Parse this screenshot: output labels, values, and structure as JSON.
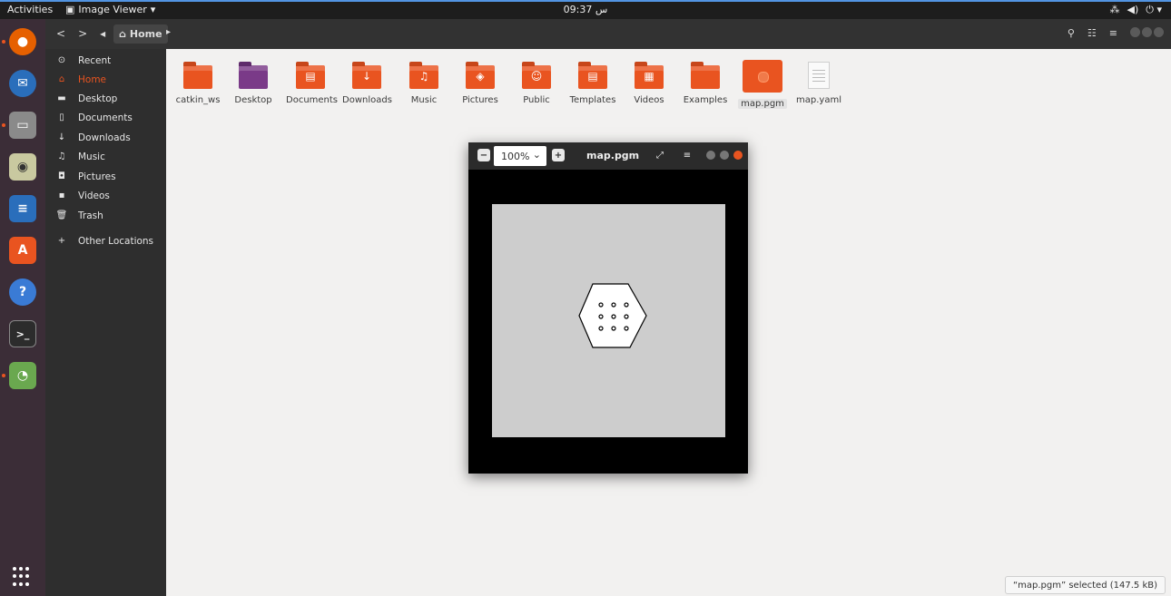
{
  "topbar": {
    "activities": "Activities",
    "app_name": "Image Viewer",
    "clock": "09:37 س",
    "tray": [
      "network-icon",
      "volume-icon",
      "power-icon"
    ]
  },
  "dock": {
    "items": [
      {
        "name": "firefox-icon",
        "color": "#e66000"
      },
      {
        "name": "thunderbird-icon",
        "color": "#2a6ebb"
      },
      {
        "name": "files-icon",
        "color": "#8a8a8a"
      },
      {
        "name": "rhythmbox-icon",
        "color": "#c9c9a0"
      },
      {
        "name": "writer-icon",
        "color": "#2a6ebb"
      },
      {
        "name": "software-icon",
        "color": "#e95420"
      },
      {
        "name": "help-icon",
        "color": "#3a7bd5"
      },
      {
        "name": "terminal-icon",
        "color": "#2c2c2c"
      },
      {
        "name": "image-viewer-icon",
        "color": "#6aa84f"
      }
    ]
  },
  "header": {
    "back": "<",
    "forward": ">",
    "crumb_label": "Home"
  },
  "sidebar": {
    "items": [
      {
        "label": "Recent",
        "icon": "⊙"
      },
      {
        "label": "Home",
        "icon": "⌂"
      },
      {
        "label": "Desktop",
        "icon": "▬"
      },
      {
        "label": "Documents",
        "icon": "▯"
      },
      {
        "label": "Downloads",
        "icon": "↓"
      },
      {
        "label": "Music",
        "icon": "♫"
      },
      {
        "label": "Pictures",
        "icon": "◘"
      },
      {
        "label": "Videos",
        "icon": "▪"
      },
      {
        "label": "Trash",
        "icon": "🗑"
      },
      {
        "label": "Other Locations",
        "icon": "+"
      }
    ]
  },
  "files": [
    {
      "label": "catkin_ws",
      "kind": "folder",
      "glyph": ""
    },
    {
      "label": "Desktop",
      "kind": "folder-purple",
      "glyph": ""
    },
    {
      "label": "Documents",
      "kind": "folder",
      "glyph": "▤"
    },
    {
      "label": "Downloads",
      "kind": "folder",
      "glyph": "↓"
    },
    {
      "label": "Music",
      "kind": "folder",
      "glyph": "♫"
    },
    {
      "label": "Pictures",
      "kind": "folder",
      "glyph": "◈"
    },
    {
      "label": "Public",
      "kind": "folder",
      "glyph": "☺"
    },
    {
      "label": "Templates",
      "kind": "folder",
      "glyph": "▤"
    },
    {
      "label": "Videos",
      "kind": "folder",
      "glyph": "▦"
    },
    {
      "label": "Examples",
      "kind": "folder",
      "glyph": ""
    },
    {
      "label": "map.pgm",
      "kind": "pgm",
      "glyph": ""
    },
    {
      "label": "map.yaml",
      "kind": "doc",
      "glyph": ""
    }
  ],
  "viewer": {
    "zoom": "100%",
    "title": "map.pgm"
  },
  "status": "“map.pgm” selected  (147.5 kB)"
}
